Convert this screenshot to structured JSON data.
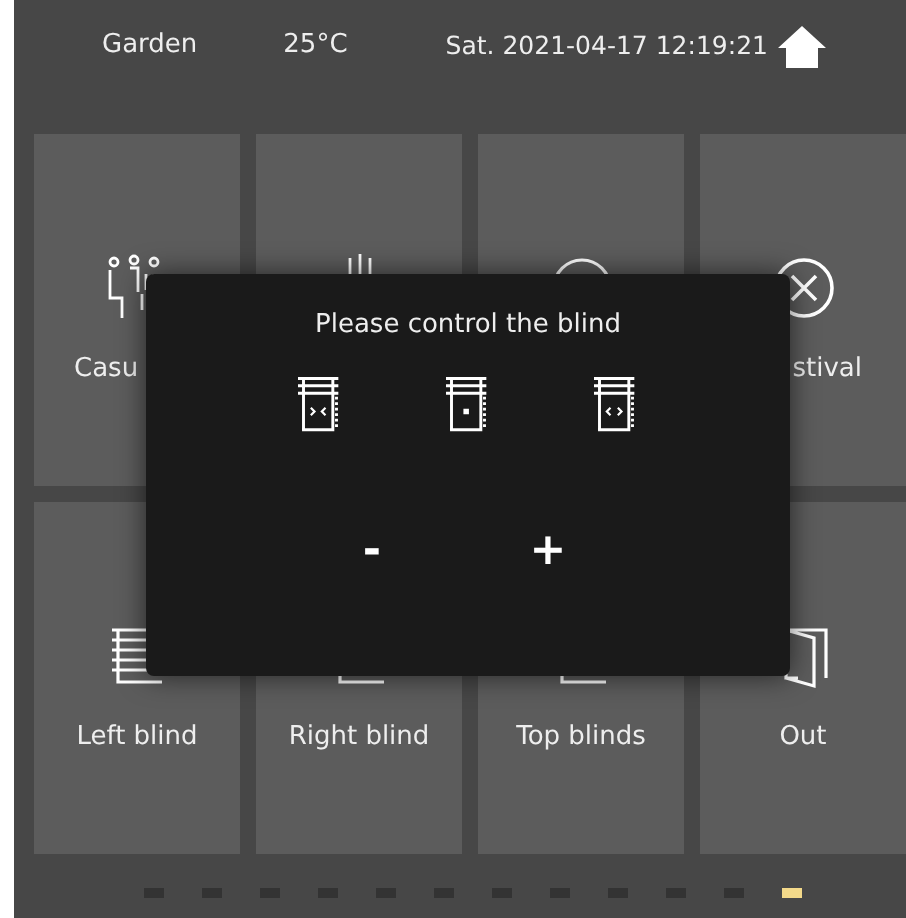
{
  "status_bar": {
    "location": "Garden",
    "temperature": "25°C",
    "datetime": "Sat. 2021-04-17 12:19:21"
  },
  "tiles": [
    {
      "label": "Casu",
      "kind": "people"
    },
    {
      "kind": "cup"
    },
    {
      "kind": "smiley"
    },
    {
      "label": "stival",
      "kind": "cross"
    },
    {
      "label": "Left blind",
      "kind": "blind"
    },
    {
      "label": "Right blind",
      "kind": "blind"
    },
    {
      "label": "Top blinds",
      "kind": "blind"
    },
    {
      "label": "Out",
      "kind": "door"
    }
  ],
  "dialog": {
    "title": "Please control the blind",
    "modes": [
      {
        "kind": "close"
      },
      {
        "kind": "stop"
      },
      {
        "kind": "open"
      }
    ],
    "buttons": [
      "-",
      "+"
    ]
  },
  "pages": [
    {
      "selected": false
    },
    {
      "selected": false
    },
    {
      "selected": false
    },
    {
      "selected": false
    },
    {
      "selected": false
    },
    {
      "selected": false
    },
    {
      "selected": false
    },
    {
      "selected": false
    },
    {
      "selected": false
    },
    {
      "selected": false
    },
    {
      "selected": false
    },
    {
      "selected": true
    }
  ]
}
